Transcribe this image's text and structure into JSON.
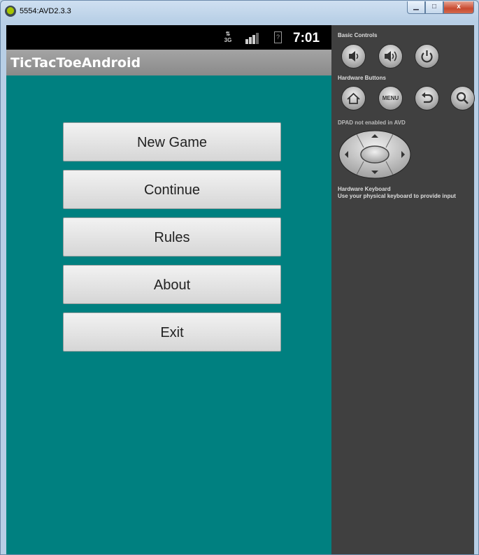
{
  "window": {
    "title": "5554:AVD2.3.3",
    "app_icon": "android-icon",
    "buttons": {
      "minimize": "▁",
      "maximize": "□",
      "close": "x"
    }
  },
  "status_bar": {
    "network": "3G",
    "network_arrows": "⇅",
    "icons": [
      "signal-icon",
      "battery-icon"
    ],
    "battery_glyph": "?",
    "time": "7:01"
  },
  "app": {
    "title": "TicTacToeAndroid",
    "background": "#008080",
    "menu": [
      "New Game",
      "Continue",
      "Rules",
      "About",
      "Exit"
    ]
  },
  "controls": {
    "basic_label": "Basic Controls",
    "basic_buttons": [
      "volume-down-icon",
      "volume-up-icon",
      "power-icon"
    ],
    "hardware_label": "Hardware Buttons",
    "hardware_buttons": [
      "home-icon",
      "menu-icon",
      "back-icon",
      "search-icon"
    ],
    "menu_text": "MENU",
    "dpad_label": "DPAD not enabled in AVD",
    "keyboard_label": "Hardware Keyboard",
    "keyboard_note": "Use your physical keyboard to provide input"
  }
}
